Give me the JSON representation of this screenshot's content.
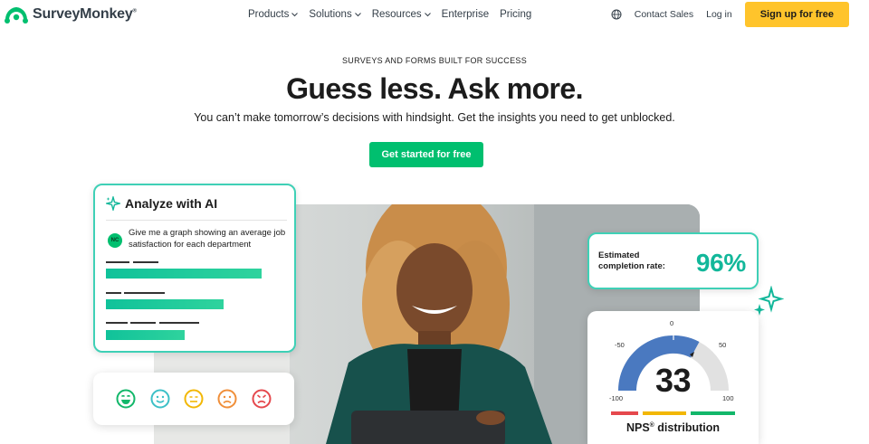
{
  "nav": {
    "brand": "SurveyMonkey",
    "brand_mark": "®",
    "menu": [
      {
        "label": "Products",
        "dropdown": true
      },
      {
        "label": "Solutions",
        "dropdown": true
      },
      {
        "label": "Resources",
        "dropdown": true
      },
      {
        "label": "Enterprise",
        "dropdown": false
      },
      {
        "label": "Pricing",
        "dropdown": false
      }
    ],
    "globe_icon": "globe-icon",
    "contact_sales": "Contact Sales",
    "login": "Log in",
    "signup": "Sign up for free"
  },
  "hero": {
    "eyebrow": "SURVEYS AND FORMS BUILT FOR SUCCESS",
    "headline": "Guess less. Ask more.",
    "subline": "You can’t make tomorrow’s decisions with hindsight. Get the insights you need to get unblocked.",
    "cta": "Get started for free"
  },
  "ai_card": {
    "title": "Analyze with AI",
    "avatar_initials": "NC",
    "prompt": "Give me a graph showing an average job satisfaction for each department"
  },
  "faces": [
    "very-happy-face-icon",
    "happy-face-icon",
    "neutral-face-icon",
    "sad-face-icon",
    "angry-face-icon"
  ],
  "completion_card": {
    "label_line1": "Estimated",
    "label_line2": "completion rate:",
    "value": "96%"
  },
  "nps_card": {
    "score": "33",
    "title": "NPS",
    "title_mark": "®",
    "title_suffix": " distribution",
    "ticks": {
      "min": "-100",
      "low": "-50",
      "mid": "0",
      "high": "50",
      "max": "100"
    }
  },
  "colors": {
    "accent_green": "#00bf6f",
    "signup_yellow": "#ffc42b",
    "teal": "#3fd0b6",
    "nps_blue": "#4a79c0"
  }
}
